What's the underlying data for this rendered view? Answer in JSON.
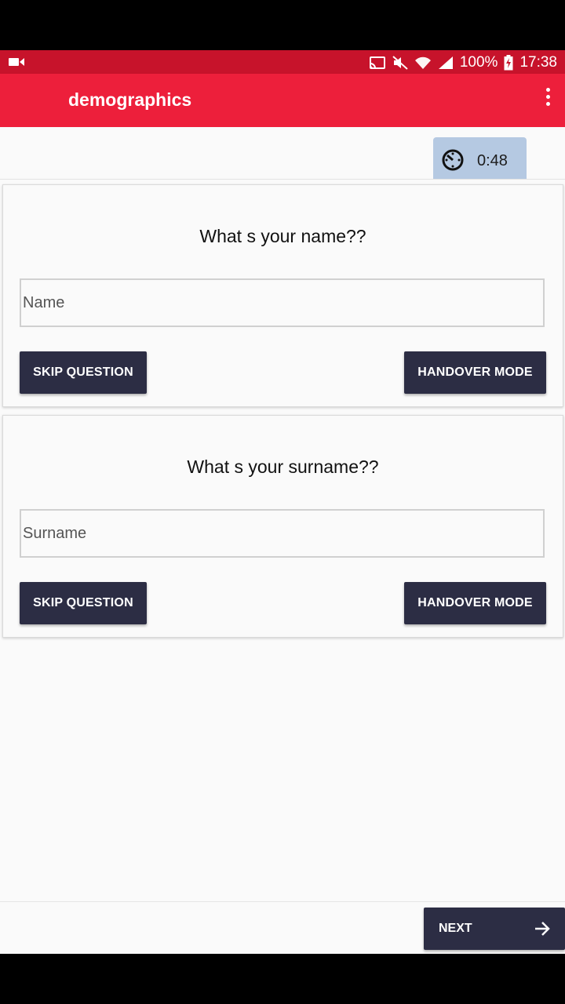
{
  "status_bar": {
    "battery": "100%",
    "time": "17:38",
    "icons": [
      "video-camera-icon",
      "cast-icon",
      "mute-icon",
      "wifi-icon",
      "signal-icon",
      "battery-charging-icon"
    ]
  },
  "app_bar": {
    "title": "demographics",
    "menu_icon": "more-vert-icon"
  },
  "timer": {
    "icon": "timer-icon",
    "value": "0:48"
  },
  "questions": [
    {
      "question": "What s your name??",
      "input_placeholder": "Name",
      "input_value": "",
      "skip_label": "SKIP QUESTION",
      "handover_label": "HANDOVER MODE"
    },
    {
      "question": "What s your surname??",
      "input_placeholder": "Surname",
      "input_value": "",
      "skip_label": "SKIP QUESTION",
      "handover_label": "HANDOVER MODE"
    }
  ],
  "footer": {
    "next_label": "NEXT",
    "next_icon": "arrow-right-icon"
  },
  "colors": {
    "status_bar": "#c7132b",
    "app_bar": "#ed1f3b",
    "button": "#2c2d44",
    "timer_chip": "#b5c9e2",
    "background": "#fafafa"
  }
}
